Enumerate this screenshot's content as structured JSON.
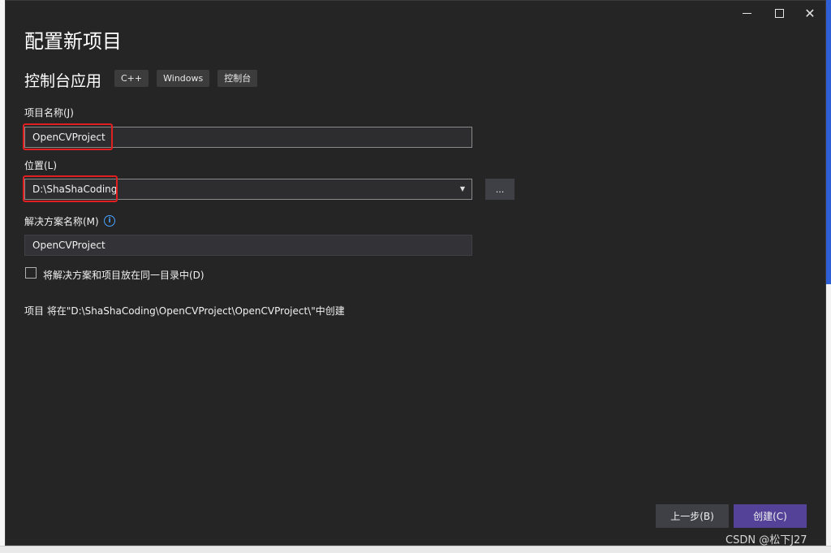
{
  "window": {
    "title": "配置新项目",
    "template_name": "控制台应用",
    "tags": [
      "C++",
      "Windows",
      "控制台"
    ]
  },
  "titlebar": {
    "minimize_icon": "minimize-icon",
    "maximize_icon": "maximize-icon",
    "close_icon": "close-icon"
  },
  "form": {
    "project_name_label": "项目名称(J)",
    "project_name_value": "OpenCVProject",
    "location_label": "位置(L)",
    "location_value": "D:\\ShaShaCoding",
    "browse_label": "...",
    "solution_name_label": "解决方案名称(M)",
    "solution_name_value": "OpenCVProject",
    "same_dir_label": "将解决方案和项目放在同一目录中(D)",
    "same_dir_checked": false,
    "location_summary": "项目 将在\"D:\\ShaShaCoding\\OpenCVProject\\OpenCVProject\\\"中创建"
  },
  "footer": {
    "back_label": "上一步(B)",
    "create_label": "创建(C)"
  },
  "watermark": "CSDN @松下J27",
  "colors": {
    "dialog_bg": "#252526",
    "create_button": "#544299",
    "highlight_box": "#e02020",
    "info_icon": "#4aa3ff"
  }
}
